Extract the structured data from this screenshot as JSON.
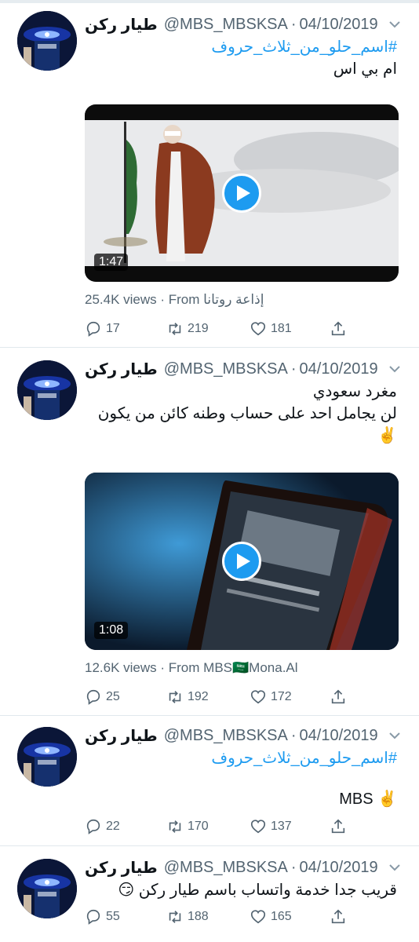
{
  "colors": {
    "link": "#1d9bf0",
    "muted": "#536471",
    "text": "#0f1419",
    "divider": "#e1e8ed"
  },
  "icons": {
    "reply": "reply-icon",
    "retweet": "retweet-icon",
    "like": "heart-icon",
    "share": "share-icon",
    "play": "play-icon",
    "more": "chevron-down-icon"
  },
  "tweets": [
    {
      "name": "طيار ركن",
      "handle": "@MBS_MBSKSA",
      "sep": "·",
      "date": "04/10/2019",
      "lines": [
        "#اسم_حلو_من_ثلاث_حروف",
        "ام بي اس"
      ],
      "media": {
        "duration": "1:47"
      },
      "views": "25.4K views · From",
      "source": "إذاعة روتانا",
      "stats": {
        "reply": "17",
        "retweet": "219",
        "like": "181"
      }
    },
    {
      "name": "طيار ركن",
      "handle": "@MBS_MBSKSA",
      "sep": "·",
      "date": "04/10/2019",
      "lines": [
        "مغرد سعودي",
        "لن يجامل احد على حساب وطنه كائن من يكون",
        "✌️"
      ],
      "media": {
        "duration": "1:08"
      },
      "views": "12.6K views · From",
      "source": "MBS🇸🇦Mona.Al",
      "stats": {
        "reply": "25",
        "retweet": "192",
        "like": "172"
      }
    },
    {
      "name": "طيار ركن",
      "handle": "@MBS_MBSKSA",
      "sep": "·",
      "date": "04/10/2019",
      "lines": [
        "#اسم_حلو_من_ثلاث_حروف",
        "MBS ✌️"
      ],
      "stats": {
        "reply": "22",
        "retweet": "170",
        "like": "137"
      }
    },
    {
      "name": "طيار ركن",
      "handle": "@MBS_MBSKSA",
      "sep": "·",
      "date": "04/10/2019",
      "lines": [
        "قريب جدا خدمة واتساب باسم طيار ركن 😏"
      ],
      "stats": {
        "reply": "55",
        "retweet": "188",
        "like": "165"
      }
    }
  ]
}
